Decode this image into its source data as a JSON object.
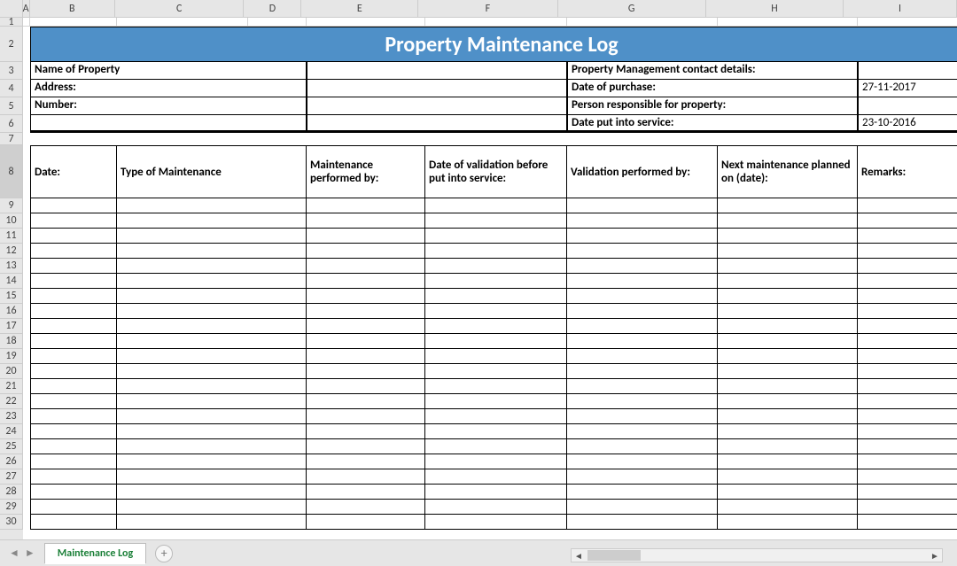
{
  "columns": [
    {
      "letter": "A",
      "width": 8
    },
    {
      "letter": "B",
      "width": 98
    },
    {
      "letter": "C",
      "width": 148
    },
    {
      "letter": "D",
      "width": 66
    },
    {
      "letter": "E",
      "width": 134
    },
    {
      "letter": "F",
      "width": 160
    },
    {
      "letter": "G",
      "width": 170
    },
    {
      "letter": "H",
      "width": 158
    },
    {
      "letter": "I",
      "width": 130
    }
  ],
  "row_heights": {
    "1": 10,
    "2": 40,
    "3": 20,
    "4": 20,
    "5": 20,
    "6": 20,
    "7": 14,
    "8": 60
  },
  "data_row_height": 17,
  "data_row_count": 22,
  "active_row": 8,
  "title": "Property Maintenance Log",
  "info": {
    "name_label": "Name of Property",
    "address_label": "Address:",
    "number_label": "Number:",
    "mgmt_label": "Property Management contact details:",
    "purchase_label": "Date of purchase:",
    "purchase_value": "27-11-2017",
    "responsible_label": "Person responsible for property:",
    "service_label": "Date put into service:",
    "service_value": "23-10-2016"
  },
  "log_headers": [
    "Date:",
    "Type of Maintenance",
    "Maintenance performed by:",
    "Date of validation before put into service:",
    "Validation performed by:",
    "Next maintenance planned on (date):",
    "Remarks:"
  ],
  "sheet_tab": "Maintenance Log",
  "icons": {
    "prev": "◄",
    "next": "►",
    "add": "+"
  }
}
